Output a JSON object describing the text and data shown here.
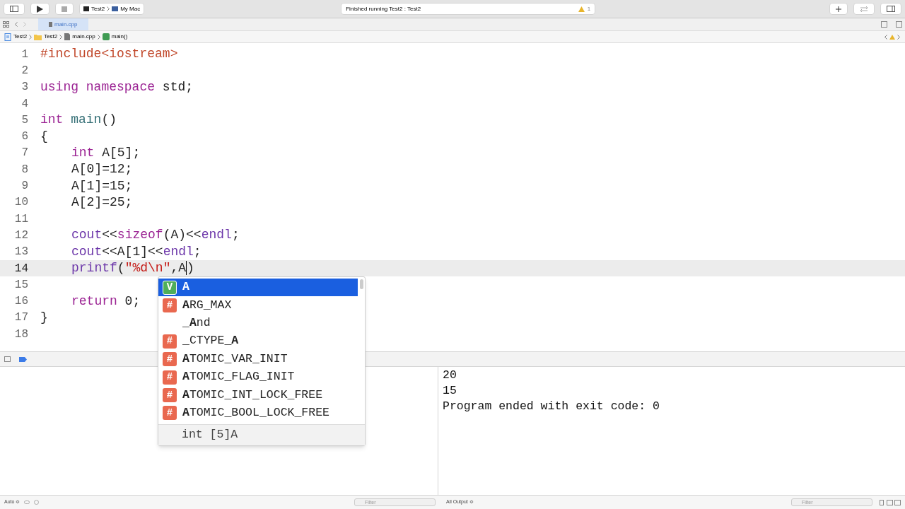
{
  "toolbar": {
    "scheme": "Test2",
    "destination": "My Mac",
    "status": "Finished running Test2 : Test2",
    "warning_count": "1"
  },
  "tabs": [
    {
      "label": "main.cpp",
      "selected": true
    }
  ],
  "jump_bar": [
    {
      "label": "Test2",
      "kind": "project"
    },
    {
      "label": "Test2",
      "kind": "folder"
    },
    {
      "label": "main.cpp",
      "kind": "file"
    },
    {
      "label": "main()",
      "kind": "function"
    }
  ],
  "editor": {
    "lines": [
      {
        "number": "1",
        "current": false,
        "indented": false,
        "tokens": [
          {
            "text": "#include<iostream>",
            "kind": "preproc"
          }
        ]
      },
      {
        "number": "2",
        "current": false
      },
      {
        "number": "3",
        "current": false,
        "indented": false,
        "tokens": [
          {
            "text": "using namespace",
            "kind": "keyword"
          },
          {
            "text": " std;",
            "kind": "plain"
          }
        ]
      },
      {
        "number": "4",
        "current": false
      },
      {
        "number": "5",
        "current": false,
        "indented": false,
        "tokens": [
          {
            "text": "int",
            "kind": "keyword"
          },
          {
            "text": " main",
            "kind": "func"
          },
          {
            "text": "()",
            "kind": "plain"
          }
        ]
      },
      {
        "number": "6",
        "current": false,
        "indented": false,
        "tokens": [
          {
            "text": "{",
            "kind": "plain"
          }
        ]
      },
      {
        "number": "7",
        "current": false,
        "indented": true,
        "tokens": [
          {
            "text": "int",
            "kind": "keyword"
          },
          {
            "text": " A[5];",
            "kind": "plain"
          }
        ]
      },
      {
        "number": "8",
        "current": false,
        "indented": true,
        "tokens": [
          {
            "text": "A[0]=12;",
            "kind": "plain"
          }
        ]
      },
      {
        "number": "9",
        "current": false,
        "indented": true,
        "tokens": [
          {
            "text": "A[1]=15;",
            "kind": "plain"
          }
        ]
      },
      {
        "number": "10",
        "current": false,
        "indented": true,
        "tokens": [
          {
            "text": "A[2]=25;",
            "kind": "plain"
          }
        ]
      },
      {
        "number": "11",
        "current": false
      },
      {
        "number": "12",
        "current": false,
        "indented": true,
        "tokens": [
          {
            "text": "cout",
            "kind": "lib"
          },
          {
            "text": "<<",
            "kind": "plain"
          },
          {
            "text": "sizeof",
            "kind": "keyword"
          },
          {
            "text": "(A)<<",
            "kind": "plain"
          },
          {
            "text": "endl",
            "kind": "lib"
          },
          {
            "text": ";",
            "kind": "plain"
          }
        ]
      },
      {
        "number": "13",
        "current": false,
        "indented": true,
        "tokens": [
          {
            "text": "cout",
            "kind": "lib"
          },
          {
            "text": "<<A[1]<<",
            "kind": "plain"
          },
          {
            "text": "endl",
            "kind": "lib"
          },
          {
            "text": ";",
            "kind": "plain"
          }
        ]
      },
      {
        "number": "14",
        "current": true,
        "indented": true,
        "tokens": [
          {
            "text": "printf",
            "kind": "lib"
          },
          {
            "text": "(",
            "kind": "plain"
          },
          {
            "text": "\"%d\\n\"",
            "kind": "string"
          },
          {
            "text": ",A",
            "kind": "plain",
            "cursor_after": true
          },
          {
            "text": ")",
            "kind": "plain"
          }
        ]
      },
      {
        "number": "15",
        "current": false
      },
      {
        "number": "16",
        "current": false,
        "indented": true,
        "tokens": [
          {
            "text": "return",
            "kind": "keyword"
          },
          {
            "text": " 0;",
            "kind": "plain"
          }
        ]
      },
      {
        "number": "17",
        "current": false,
        "indented": false,
        "tokens": [
          {
            "text": "}",
            "kind": "plain"
          }
        ]
      },
      {
        "number": "18",
        "current": false
      }
    ]
  },
  "completion": {
    "items": [
      {
        "label": "**A**",
        "kind": "variable",
        "badge": "V",
        "selected": true
      },
      {
        "label": "**A**RG_MAX",
        "kind": "macro",
        "badge": "#",
        "selected": false
      },
      {
        "label": "_**A**nd",
        "kind": "none",
        "selected": false
      },
      {
        "label": "_CTYPE_**A**",
        "kind": "macro",
        "badge": "#",
        "selected": false
      },
      {
        "label": "**A**TOMIC_VAR_INIT",
        "kind": "macro",
        "badge": "#",
        "selected": false
      },
      {
        "label": "**A**TOMIC_FLAG_INIT",
        "kind": "macro",
        "badge": "#",
        "selected": false
      },
      {
        "label": "**A**TOMIC_INT_LOCK_FREE",
        "kind": "macro",
        "badge": "#",
        "selected": false
      },
      {
        "label": "**A**TOMIC_BOOL_LOCK_FREE",
        "kind": "macro",
        "badge": "#",
        "selected": false
      }
    ],
    "detail": "int [5]A"
  },
  "console": {
    "output": [
      "20",
      "15",
      "Program ended with exit code: 0"
    ]
  },
  "bottom_bar": {
    "variables_mode": "Auto ≎",
    "variables_filter": {
      "placeholder": "Filter"
    },
    "output_mode": "All Output ≎",
    "output_filter": {
      "placeholder": "Filter"
    }
  }
}
